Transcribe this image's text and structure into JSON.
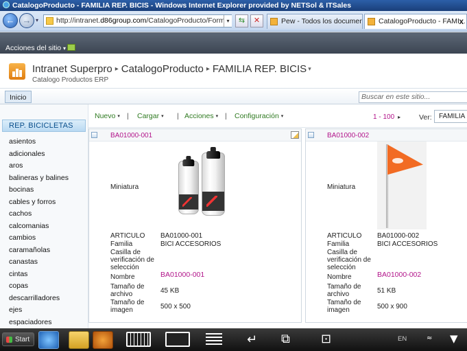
{
  "window": {
    "title": "CatalogoProducto - FAMILIA REP. BICIS - Windows Internet Explorer provided by NETSol & ITSales"
  },
  "browser": {
    "back_symbol": "←",
    "forward_symbol": "→",
    "dropdown_symbol": "▾",
    "url_prefix": "http://intranet.",
    "url_domain": "d86group.com",
    "url_rest": "/CatalogoProducto/Forms/FAI",
    "refresh_symbol": "⇆",
    "stop_symbol": "✕",
    "tabs": [
      {
        "label": "Pew - Todos los documentos"
      },
      {
        "label": "CatalogoProducto - FAMI..."
      }
    ],
    "tab_close": "x"
  },
  "sitebar": {
    "actions_label": "Acciones del sitio",
    "actions_arrow": "▾"
  },
  "header": {
    "crumbs": [
      "Intranet Superpro",
      "CatalogoProducto",
      "FAMILIA REP. BICIS"
    ],
    "crumb_sep": "▸",
    "crumb_drop": "▾",
    "subtitle": "Catalogo Productos ERP"
  },
  "topnav": {
    "home_tab": "Inicio",
    "search_placeholder": "Buscar en este sitio..."
  },
  "leftnav": {
    "heading": "REP. BICICLETAS",
    "items": [
      "asientos",
      "adicionales",
      "aros",
      "balineras y balines",
      "bocinas",
      "cables y forros",
      "cachos",
      "calcomanias",
      "cambios",
      "caramañolas",
      "canastas",
      "cintas",
      "copas",
      "descarrilladores",
      "ejes",
      "espaciadores"
    ]
  },
  "toolbar": {
    "menus": [
      "Nuevo",
      "Cargar",
      "Acciones",
      "Configuración"
    ],
    "menu_arrow": "▾",
    "separator": "|",
    "pager": "1 - 100",
    "pager_next": "▸",
    "view_label": "Ver:",
    "view_value": "FAMILIA"
  },
  "labels": {
    "thumbnail": "Miniatura",
    "article": "ARTICULO",
    "family": "Familia",
    "checkbox": "Casilla de verificación de selección",
    "name": "Nombre",
    "file_size": "Tamaño de archivo",
    "image_size": "Tamaño de imagen"
  },
  "cards": [
    {
      "id": "BA01000-001",
      "article": "BA01000-001",
      "family": "BICI ACCESORIOS",
      "name": "BA01000-001",
      "file_size": "45 KB",
      "image_size": "500 x 500"
    },
    {
      "id": "BA01000-002",
      "article": "BA01000-002",
      "family": "BICI ACCESORIOS",
      "name": "BA01000-002",
      "file_size": "51 KB",
      "image_size": "500 x 900"
    }
  ],
  "taskbar": {
    "start_label": "Start",
    "lang": "EN",
    "enter_symbol": "↵",
    "window_symbol": "⧉",
    "lock_symbol": "⊡",
    "tray_symbol": "≈",
    "chevron_symbol": "▼"
  }
}
